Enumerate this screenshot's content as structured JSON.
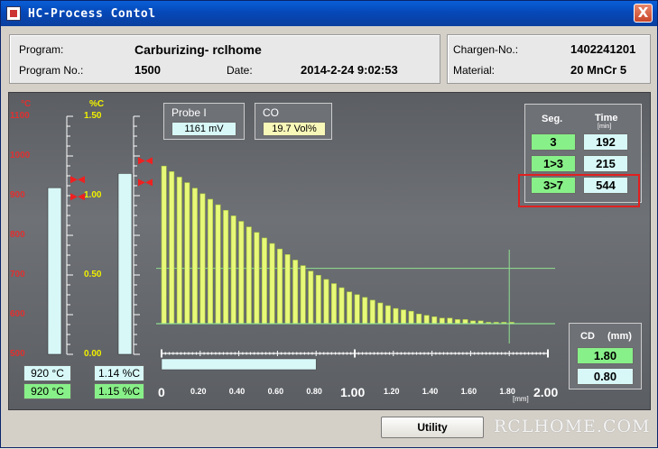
{
  "window": {
    "title": "HC-Process Contol",
    "close_label": "X"
  },
  "program_panel": {
    "program_label": "Program:",
    "program_value": "Carburizing- rclhome",
    "program_no_label": "Program No.:",
    "program_no_value": "1500",
    "date_label": "Date:",
    "date_value": "2014-2-24 9:02:53"
  },
  "charge_panel": {
    "charge_label": "Chargen-No.:",
    "charge_value": "1402241201",
    "material_label": "Material:",
    "material_value": "20 MnCr 5"
  },
  "temp_gauge": {
    "unit": "°C",
    "ticks": [
      "1100",
      "1000",
      "900",
      "800",
      "700",
      "600",
      "500"
    ],
    "min": 500,
    "max": 1100,
    "actual": 920,
    "setpoint": 920,
    "actual_label": "920 °C",
    "setpoint_label": "920 °C",
    "colors": {
      "scale": "#E03030",
      "bar": "#D8F8F8"
    }
  },
  "carbon_gauge": {
    "unit": "%C",
    "ticks": [
      "1.50",
      "1.00",
      "0.50",
      "0.00"
    ],
    "min": 0.0,
    "max": 1.5,
    "actual": 1.14,
    "setpoint": 1.15,
    "actual_label": "1.14 %C",
    "setpoint_label": "1.15 %C",
    "colors": {
      "scale": "#F0F000",
      "bar": "#D8F8F8"
    }
  },
  "probe": {
    "label": "Probe I",
    "value": "1161 mV"
  },
  "co": {
    "label": "CO",
    "value": "19.7 Vol%"
  },
  "segments": {
    "seg_header": "Seg.",
    "time_header": "Time",
    "time_unit": "[min]",
    "rows": [
      {
        "seg": "3",
        "time": "192"
      },
      {
        "seg": "1>3",
        "time": "215"
      },
      {
        "seg": "3>7",
        "time": "544"
      }
    ],
    "highlight_color": "#E02020"
  },
  "cd": {
    "label": "CD",
    "unit": "(mm)",
    "value1": "1.80",
    "value2": "0.80"
  },
  "chart_data": {
    "type": "bar",
    "title": "",
    "xlabel": "[mm]",
    "ylabel": "%C",
    "xlim": [
      0,
      2.0
    ],
    "ylim": [
      0,
      1.5
    ],
    "x_ticks": [
      "0",
      "0.20",
      "0.40",
      "0.60",
      "0.80",
      "1.00",
      "1.20",
      "1.40",
      "1.60",
      "1.80",
      "2.00"
    ],
    "x": [
      0.0,
      0.04,
      0.08,
      0.12,
      0.16,
      0.2,
      0.24,
      0.28,
      0.32,
      0.36,
      0.4,
      0.44,
      0.48,
      0.52,
      0.56,
      0.6,
      0.64,
      0.68,
      0.72,
      0.76,
      0.8,
      0.84,
      0.88,
      0.92,
      0.96,
      1.0,
      1.04,
      1.08,
      1.12,
      1.16,
      1.2,
      1.24,
      1.28,
      1.32,
      1.36,
      1.4,
      1.44,
      1.48,
      1.52,
      1.56,
      1.6,
      1.64,
      1.68,
      1.72,
      1.76,
      1.8
    ],
    "values": [
      1.14,
      1.1,
      1.06,
      1.02,
      0.98,
      0.94,
      0.9,
      0.86,
      0.82,
      0.78,
      0.74,
      0.7,
      0.66,
      0.62,
      0.58,
      0.54,
      0.5,
      0.46,
      0.42,
      0.38,
      0.35,
      0.32,
      0.29,
      0.26,
      0.23,
      0.21,
      0.19,
      0.17,
      0.15,
      0.13,
      0.11,
      0.1,
      0.09,
      0.07,
      0.06,
      0.05,
      0.04,
      0.04,
      0.03,
      0.03,
      0.02,
      0.02,
      0.01,
      0.01,
      0.01,
      0.01
    ],
    "target_depth": 1.8,
    "target_carbon": 0.4,
    "depth_bar_end": 0.8,
    "colors": {
      "bar": "#E8F878",
      "bar_shade": "#A8C840",
      "grid": "#90E090",
      "progress": "#D8F8F8"
    }
  },
  "footer": {
    "utility_label": "Utility",
    "watermark": "RCLHOME.COM"
  }
}
